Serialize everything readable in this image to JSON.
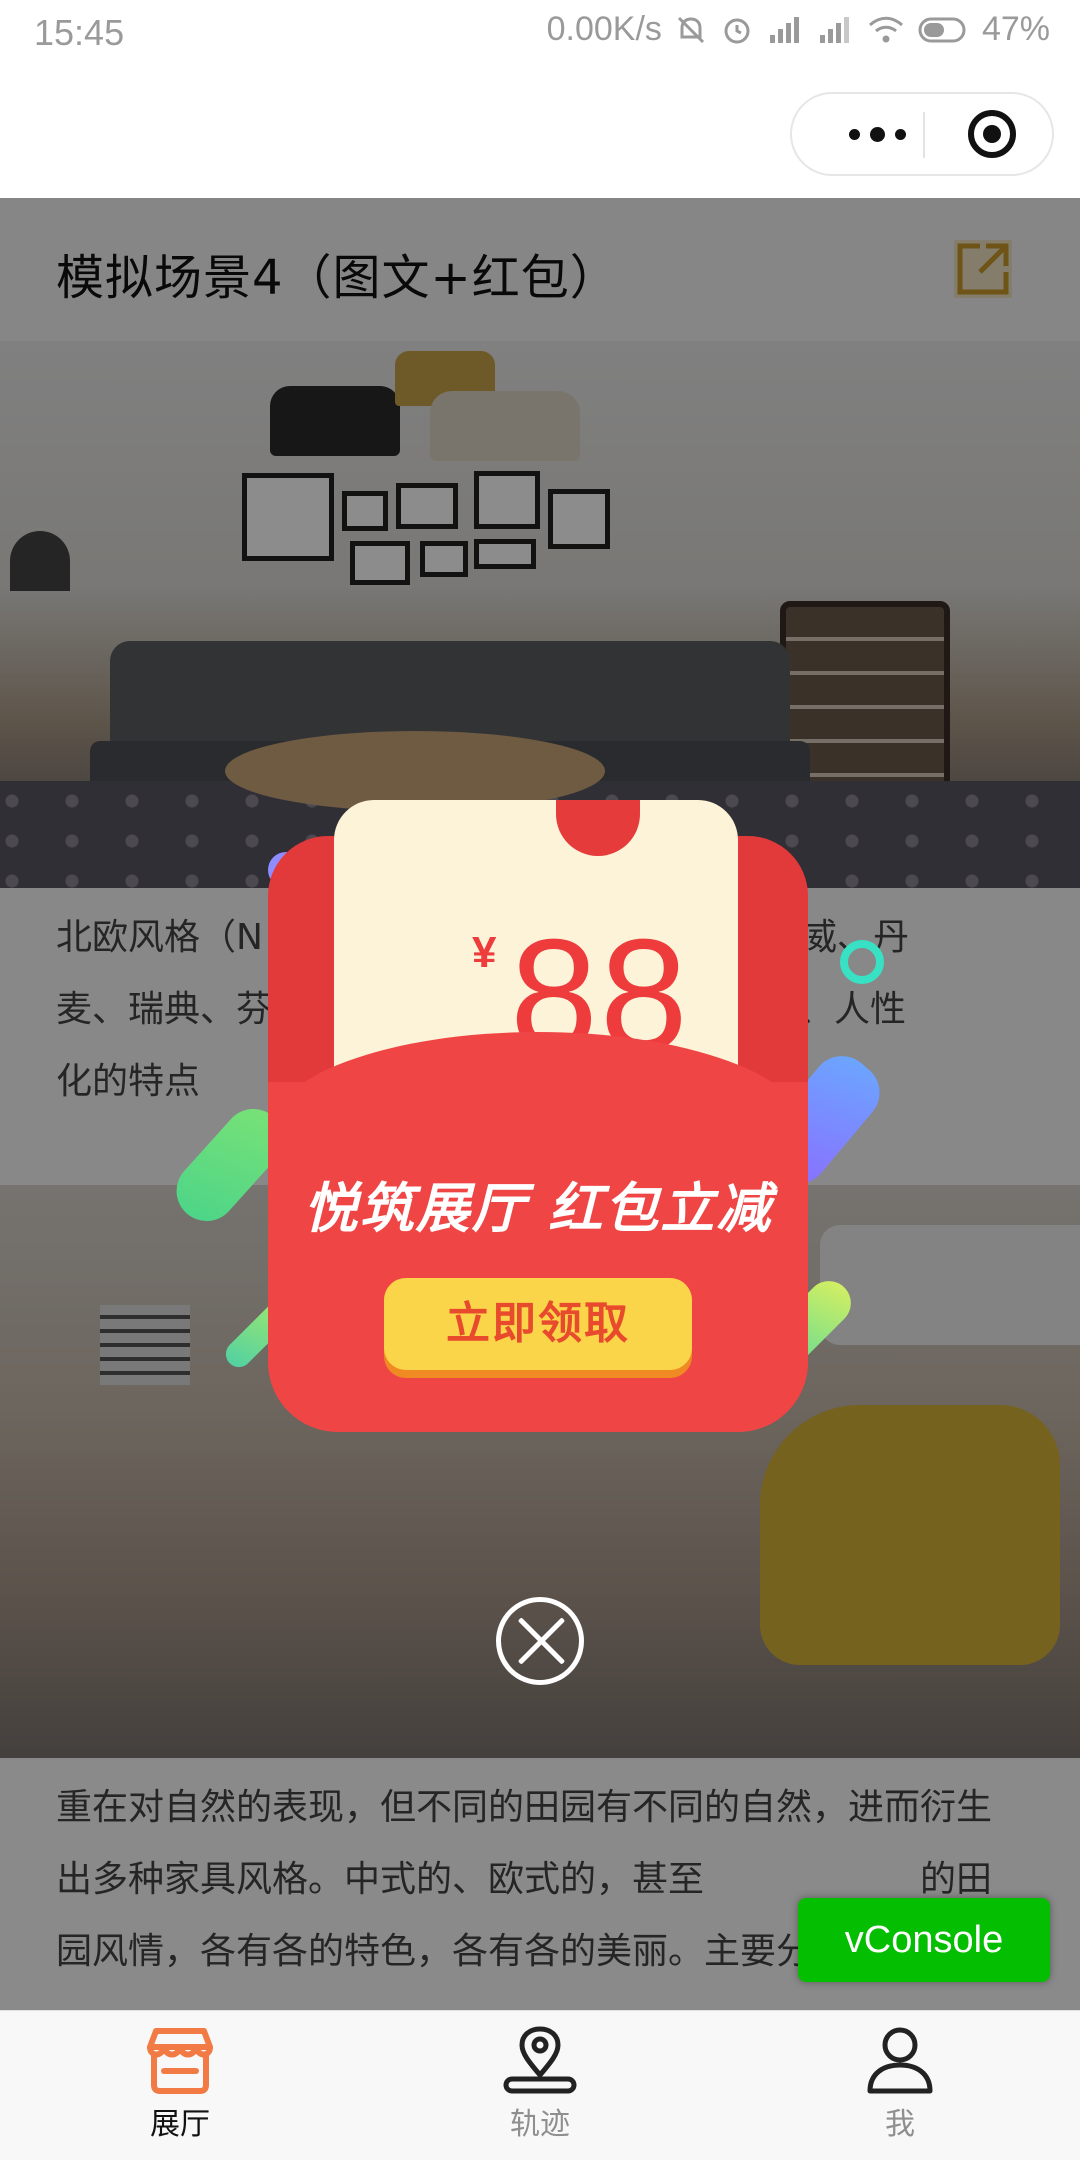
{
  "status_bar": {
    "time": "15:45",
    "network_speed": "0.00K/s",
    "battery": "47%"
  },
  "header": {
    "capsule_more_icon": "more-dots-icon",
    "capsule_close_icon": "target-close-icon"
  },
  "page": {
    "title": "模拟场景4（图文+红包）",
    "share_icon": "share-icon",
    "paragraph_1_lines": [
      "北欧风格（N",
      "国家挪威、丹",
      "麦、瑞典、芬",
      "、自然、人性",
      "化的特点"
    ],
    "paragraph_1": "北欧风格（N　　　　　　　　　　国家挪威、丹\n麦、瑞典、芬　　　　　　　　　、自然、人性\n化的特点",
    "paragraph_2": "重在对自然的表现，但不同的田园有不同的自然，进而衍生出多种家具风格。中式的、欧式的，甚至　　　　　　的田园风情，各有各的特色，各有各的美丽。主要分英"
  },
  "red_packet": {
    "currency": "¥",
    "amount": "88",
    "slogan": "悦筑展厅 红包立减",
    "claim_button": "立即领取",
    "colors": {
      "red": "#f04444",
      "button": "#fbd549",
      "coupon": "#fdf3d8"
    }
  },
  "overlay": {
    "close_icon": "close-circle-icon"
  },
  "vconsole": {
    "label": "vConsole",
    "color": "#04be02"
  },
  "tabbar": {
    "tabs": [
      {
        "label": "展厅",
        "icon": "store-icon",
        "active": true
      },
      {
        "label": "轨迹",
        "icon": "location-pin-icon",
        "active": false
      },
      {
        "label": "我",
        "icon": "user-icon",
        "active": false
      }
    ],
    "accent": "#f27a45"
  }
}
